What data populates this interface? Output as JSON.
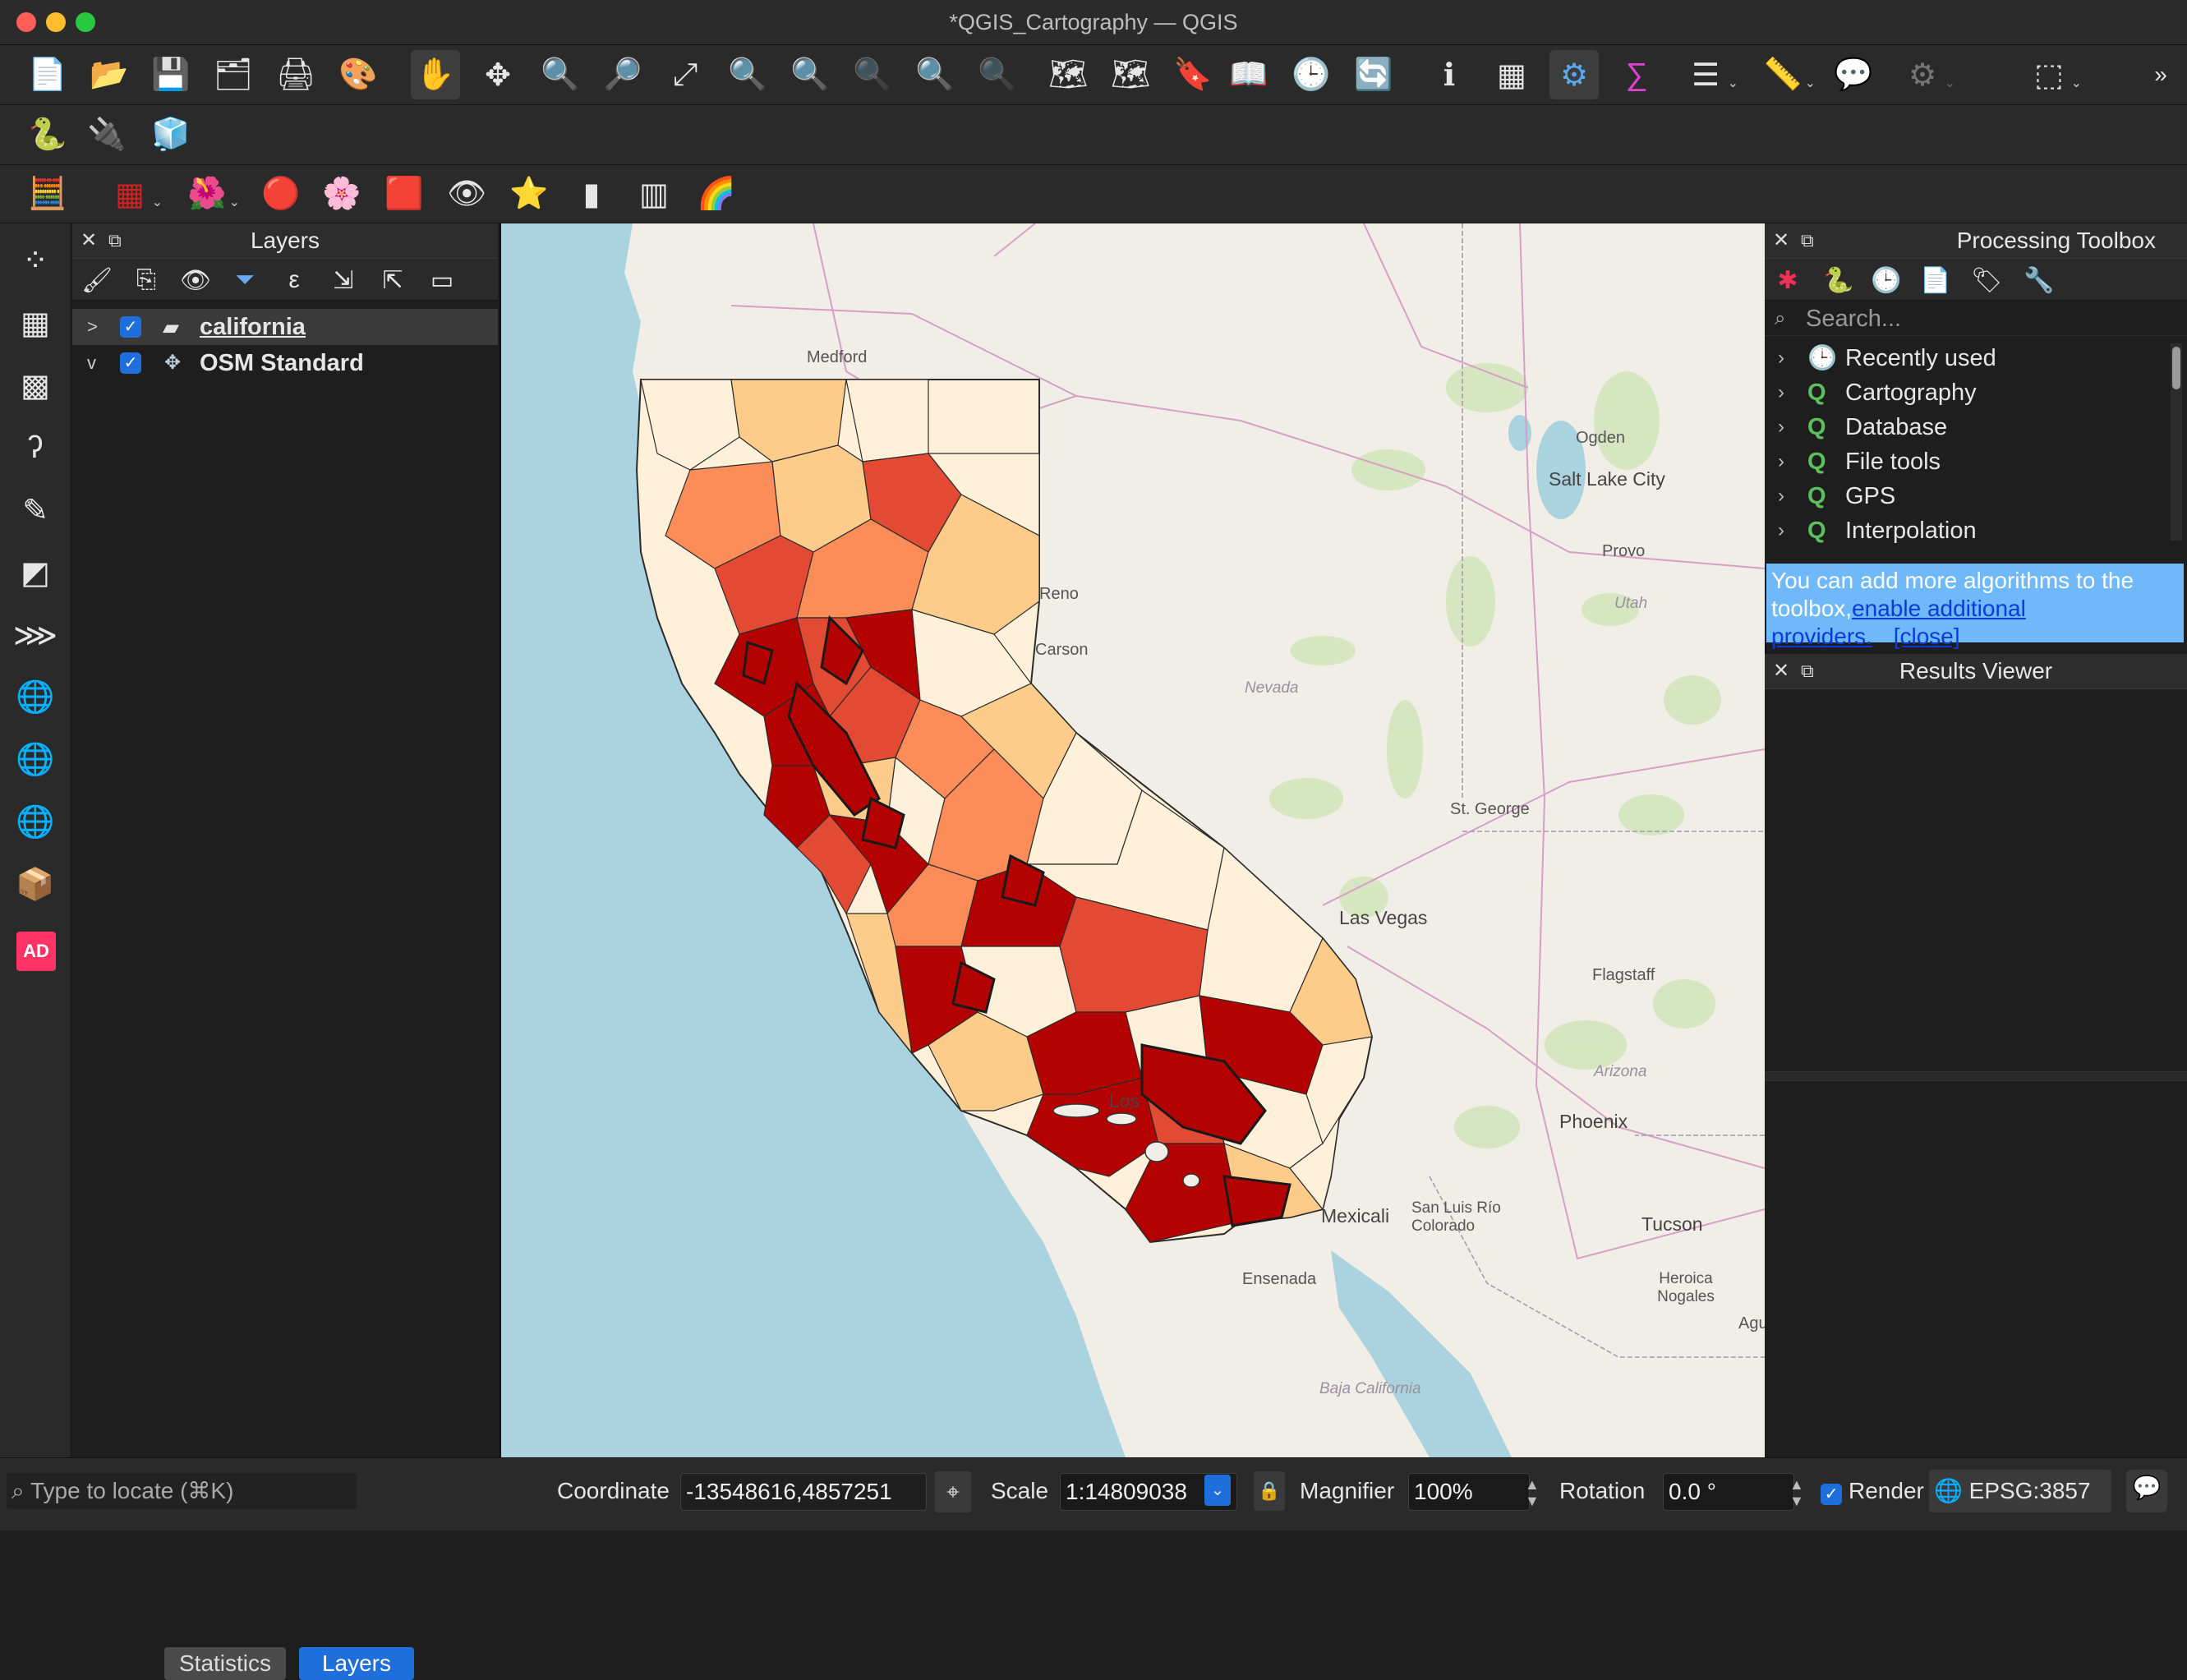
{
  "window": {
    "title": "*QGIS_Cartography — QGIS"
  },
  "colors": {
    "accent": "#1e6fdc",
    "choropleth": [
      "#fef0d9",
      "#fdcc8a",
      "#fc8d59",
      "#e34a33",
      "#b30000"
    ],
    "water": "#aad3df",
    "land": "#f2efe9"
  },
  "toolbar1": {
    "icons": [
      "new-project-icon",
      "open-project-icon",
      "save-project-icon",
      "save-as-icon",
      "print-layout-icon",
      "style-manager-icon",
      "pan-icon",
      "pan-to-selection-icon",
      "zoom-in-icon",
      "zoom-out-icon",
      "zoom-full-icon",
      "zoom-to-selection-icon",
      "zoom-to-layer-icon",
      "zoom-native-icon",
      "zoom-last-icon",
      "zoom-next-icon",
      "new-map-view-icon",
      "new-3d-view-icon",
      "new-bookmark-icon",
      "show-bookmarks-icon",
      "temporal-controller-icon",
      "refresh-icon",
      "identify-icon",
      "attribute-table-icon",
      "processing-toolbox-icon",
      "statistics-sum-icon",
      "open-table-icon",
      "measure-icon",
      "annotation-icon",
      "settings-icon",
      "select-icon"
    ]
  },
  "toolbar2": {
    "icons": [
      "python-console-icon",
      "plugin-icon",
      "qgis-layer-icon"
    ]
  },
  "toolbar3": {
    "icons": [
      "raster-calculator-icon",
      "grid-icon",
      "flower-icon",
      "pattern-icon",
      "blossom-icon",
      "noise-icon",
      "eye-icon",
      "star-icon",
      "gradient-icon",
      "spectrum-icon",
      "heatmap-icon"
    ]
  },
  "layers_panel": {
    "title": "Layers",
    "items": [
      {
        "name": "california",
        "checked": true,
        "expand": ">"
      },
      {
        "name": "OSM Standard",
        "checked": true,
        "expand": "v"
      }
    ],
    "tabs": [
      "Statistics",
      "Layers"
    ]
  },
  "processing_panel": {
    "title": "Processing Toolbox",
    "search_placeholder": "Search...",
    "items": [
      "Recently used",
      "Cartography",
      "Database",
      "File tools",
      "GPS",
      "Interpolation"
    ],
    "info": {
      "text": "You can add more algorithms to the toolbox,",
      "link1": "enable additional",
      "link2": "providers.",
      "close": "[close]"
    }
  },
  "results_panel": {
    "title": "Results Viewer"
  },
  "map": {
    "labels": [
      "Medford",
      "Ogden",
      "Salt Lake City",
      "Provo",
      "Utah",
      "Reno",
      "Carson",
      "Nevada",
      "St. George",
      "Las Vegas",
      "Flagstaff",
      "Arizona",
      "Phoenix",
      "Los",
      "Mexicali",
      "San Luis Río Colorado",
      "Tucson",
      "Heroica Nogales",
      "Ensenada",
      "Baja California",
      "Agua"
    ]
  },
  "statusbar": {
    "locate_placeholder": "Type to locate (⌘K)",
    "coordinate_label": "Coordinate",
    "coordinate_value": "-13548616,4857251",
    "scale_label": "Scale",
    "scale_value": "1:14809038",
    "magnifier_label": "Magnifier",
    "magnifier_value": "100%",
    "rotation_label": "Rotation",
    "rotation_value": "0.0 °",
    "render_label": "Render",
    "crs": "EPSG:3857"
  }
}
